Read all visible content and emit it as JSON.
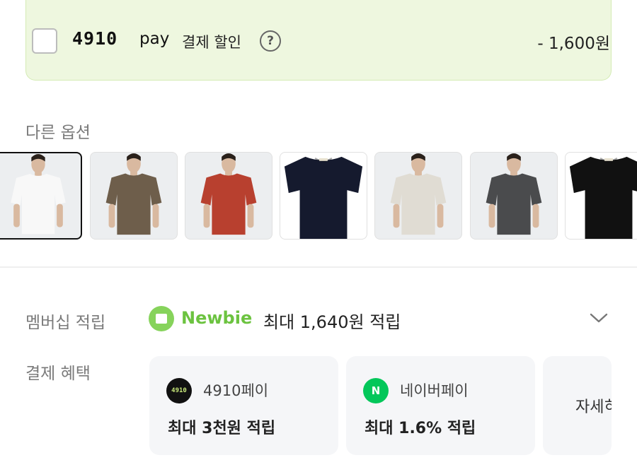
{
  "pay_discount": {
    "logo": "4910",
    "logo_suffix": "pay",
    "label": "결제 할인",
    "amount": "- 1,600원"
  },
  "options": {
    "title": "다른 옵션",
    "items": [
      {
        "color_name": "white",
        "shirt": "#f8f8f8",
        "bg": "#eceef0",
        "model": true,
        "selected": true
      },
      {
        "color_name": "brown",
        "shirt": "#6e5e4b",
        "bg": "#eceef0",
        "model": true,
        "selected": false
      },
      {
        "color_name": "red",
        "shirt": "#b8402f",
        "bg": "#eceef0",
        "model": true,
        "selected": false
      },
      {
        "color_name": "navy",
        "shirt": "#151a2e",
        "bg": "#ffffff",
        "model": false,
        "selected": false
      },
      {
        "color_name": "beige",
        "shirt": "#e0dcd3",
        "bg": "#eceef0",
        "model": true,
        "selected": false
      },
      {
        "color_name": "charcoal",
        "shirt": "#4a4b4d",
        "bg": "#eceef0",
        "model": true,
        "selected": false
      },
      {
        "color_name": "black",
        "shirt": "#111111",
        "bg": "#ffffff",
        "model": false,
        "selected": false
      }
    ]
  },
  "membership": {
    "label": "멤버십 적립",
    "grade": "Newbie",
    "text": "최대 1,640원 적립"
  },
  "payment_benefits": {
    "label": "결제 혜택",
    "cards": [
      {
        "name": "4910페이",
        "benefit": "최대 3천원 적립",
        "icon": "4910"
      },
      {
        "name": "네이버페이",
        "benefit": "최대 1.6% 적립",
        "icon": "N"
      }
    ],
    "more": "자세히"
  },
  "colors": {
    "accent_green": "#6cc340",
    "pay_box_bg": "#eef7df",
    "naver_green": "#03c75a"
  }
}
